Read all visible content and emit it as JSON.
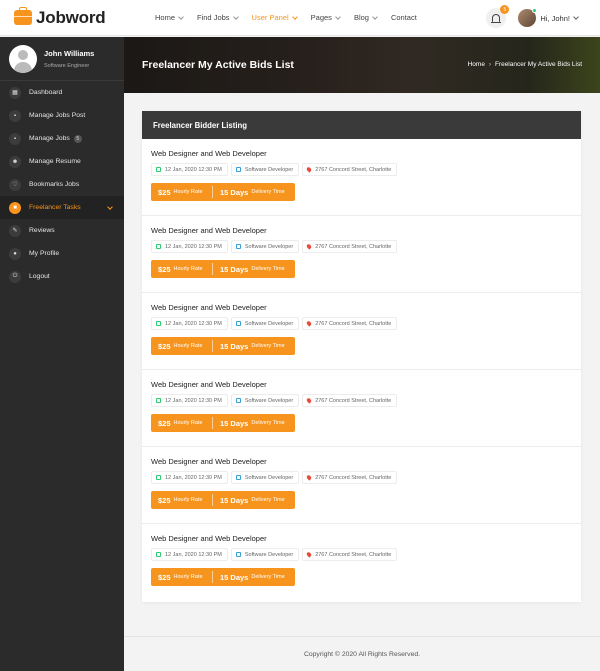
{
  "brand": {
    "name": "Jobword"
  },
  "nav": {
    "items": [
      {
        "label": "Home",
        "dropdown": true,
        "active": false
      },
      {
        "label": "Find Jobs",
        "dropdown": true,
        "active": false
      },
      {
        "label": "User Panel",
        "dropdown": true,
        "active": true
      },
      {
        "label": "Pages",
        "dropdown": true,
        "active": false
      },
      {
        "label": "Blog",
        "dropdown": true,
        "active": false
      },
      {
        "label": "Contact",
        "dropdown": false,
        "active": false
      }
    ],
    "notification_count": "5",
    "greeting": "Hi, John!"
  },
  "sidebar": {
    "profile": {
      "name": "John Williams",
      "role": "Software Engineer"
    },
    "items": [
      {
        "label": "Dashboard",
        "icon": "dashboard-icon"
      },
      {
        "label": "Manage Jobs Post",
        "icon": "briefcase-icon"
      },
      {
        "label": "Manage Jobs",
        "icon": "briefcase-icon",
        "badge": "5"
      },
      {
        "label": "Manage Resume",
        "icon": "users-icon"
      },
      {
        "label": "Bookmarks Jobs",
        "icon": "heart-icon"
      },
      {
        "label": "Freelancer Tasks",
        "icon": "task-icon",
        "active": true
      },
      {
        "label": "Reviews",
        "icon": "comment-icon"
      },
      {
        "label": "My Profile",
        "icon": "user-icon"
      },
      {
        "label": "Logout",
        "icon": "power-icon"
      }
    ]
  },
  "hero": {
    "title": "Freelancer My Active Bids List",
    "breadcrumb": {
      "home": "Home",
      "separator": "›",
      "current": "Freelancer My Active Bids List"
    }
  },
  "panel": {
    "title": "Freelancer Bidder Listing",
    "bids": [
      {
        "title": "Web Designer and Web Developer",
        "date": "12 Jan, 2020 12:30 PM",
        "category": "Software Developer",
        "location": "2767 Concord Street, Charlotte",
        "rate": "$25",
        "rate_label": "Hourly Rate",
        "days": "15 Days",
        "days_label": "Delivery Time"
      },
      {
        "title": "Web Designer and Web Developer",
        "date": "12 Jan, 2020 12:30 PM",
        "category": "Software Developer",
        "location": "2767 Concord Street, Charlotte",
        "rate": "$25",
        "rate_label": "Hourly Rate",
        "days": "15 Days",
        "days_label": "Delivery Time"
      },
      {
        "title": "Web Designer and Web Developer",
        "date": "12 Jan, 2020 12:30 PM",
        "category": "Software Developer",
        "location": "2767 Concord Street, Charlotte",
        "rate": "$25",
        "rate_label": "Hourly Rate",
        "days": "15 Days",
        "days_label": "Delivery Time"
      },
      {
        "title": "Web Designer and Web Developer",
        "date": "12 Jan, 2020 12:30 PM",
        "category": "Software Developer",
        "location": "2767 Concord Street, Charlotte",
        "rate": "$25",
        "rate_label": "Hourly Rate",
        "days": "15 Days",
        "days_label": "Delivery Time"
      },
      {
        "title": "Web Designer and Web Developer",
        "date": "12 Jan, 2020 12:30 PM",
        "category": "Software Developer",
        "location": "2767 Concord Street, Charlotte",
        "rate": "$25",
        "rate_label": "Hourly Rate",
        "days": "15 Days",
        "days_label": "Delivery Time"
      },
      {
        "title": "Web Designer and Web Developer",
        "date": "12 Jan, 2020 12:30 PM",
        "category": "Software Developer",
        "location": "2767 Concord Street, Charlotte",
        "rate": "$25",
        "rate_label": "Hourly Rate",
        "days": "15 Days",
        "days_label": "Delivery Time"
      }
    ]
  },
  "footer": {
    "copyright": "Copyright © 2020 All Rights Reserved."
  },
  "colors": {
    "accent": "#f7941d",
    "sidebar_bg": "#2b2b2b",
    "panel_head": "#3a3a3a"
  }
}
